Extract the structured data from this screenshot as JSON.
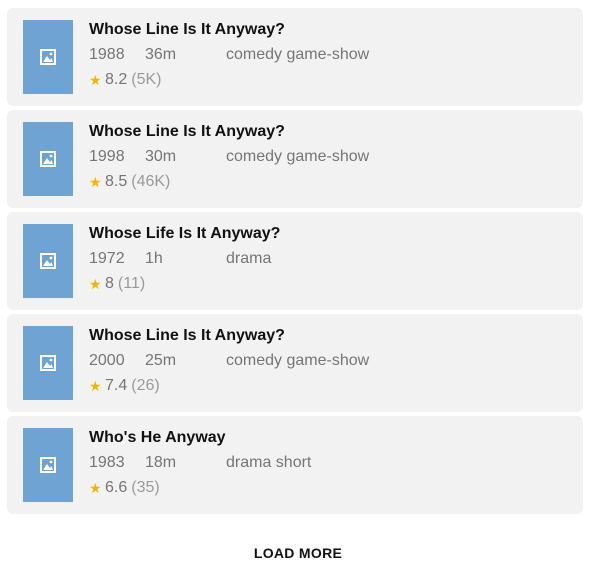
{
  "results": [
    {
      "title": "Whose Line Is It Anyway?",
      "year": "1988",
      "duration": "36m",
      "genres": "comedy game-show",
      "rating": "8.2",
      "votes": "(5K)",
      "thumbnail_icon": "image-placeholder-icon"
    },
    {
      "title": "Whose Line Is It Anyway?",
      "year": "1998",
      "duration": "30m",
      "genres": "comedy game-show",
      "rating": "8.5",
      "votes": "(46K)",
      "thumbnail_icon": "image-placeholder-icon"
    },
    {
      "title": "Whose Life Is It Anyway?",
      "year": "1972",
      "duration": "1h",
      "genres": "drama",
      "rating": "8",
      "votes": "(11)",
      "thumbnail_icon": "image-placeholder-icon"
    },
    {
      "title": "Whose Line Is It Anyway?",
      "year": "2000",
      "duration": "25m",
      "genres": "comedy game-show",
      "rating": "7.4",
      "votes": "(26)",
      "thumbnail_icon": "image-placeholder-icon"
    },
    {
      "title": "Who's He Anyway",
      "year": "1983",
      "duration": "18m",
      "genres": "drama short",
      "rating": "6.6",
      "votes": "(35)",
      "thumbnail_icon": "image-placeholder-icon"
    }
  ],
  "load_more_label": "LOAD MORE",
  "colors": {
    "card_background": "#f2f2f2",
    "thumbnail_placeholder": "#6ea3d3",
    "star": "#f5b400"
  }
}
